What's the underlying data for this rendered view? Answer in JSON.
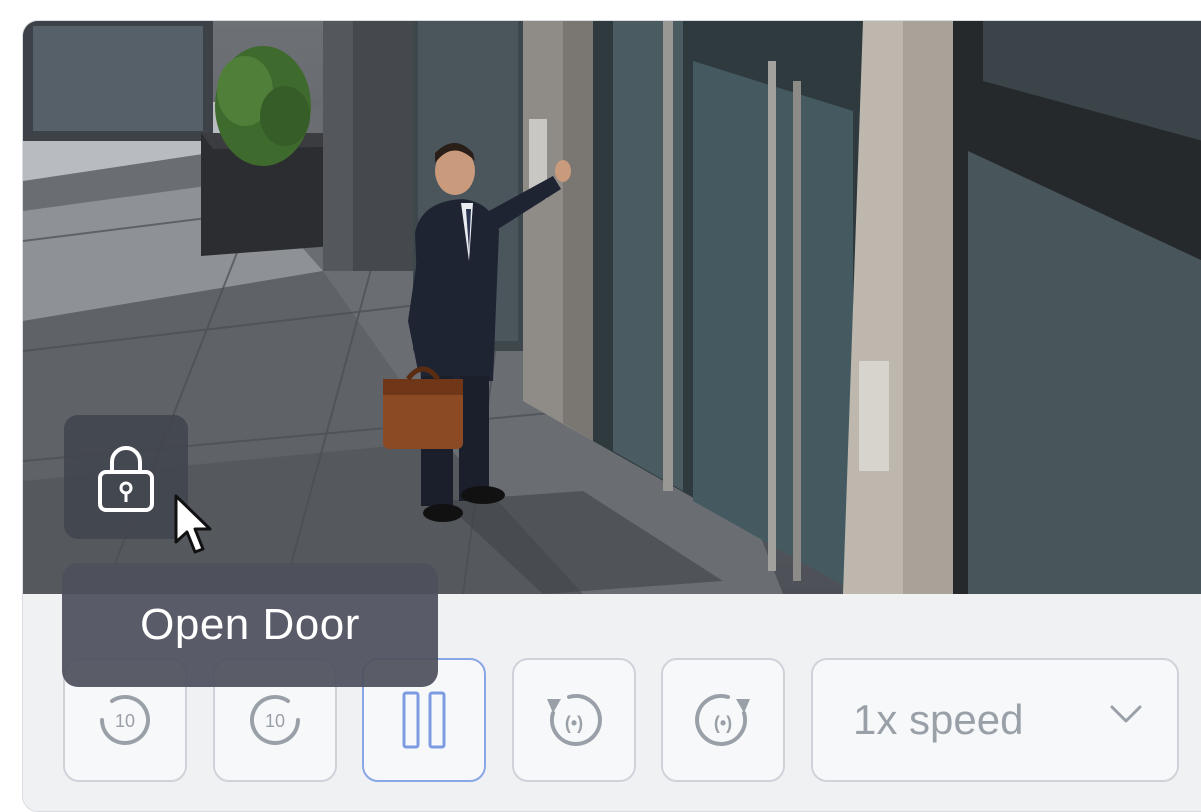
{
  "video": {
    "description_icon": "camera-feed"
  },
  "controls": {
    "rewind_10_label": "10",
    "forward_10_label": "10",
    "pause_icon": "pause-icon",
    "rotate_left_icon": "rotate-left-icon",
    "rotate_right_icon": "rotate-right-icon",
    "speed_value": "1x speed",
    "speed_icon": "chevron-down-icon"
  },
  "overlay": {
    "lock_icon": "lock-icon",
    "tooltip_text": "Open Door"
  },
  "colors": {
    "active_border": "#8aa6e6",
    "button_border": "#cfd3d9",
    "overlay_bg": "#42454e",
    "tooltip_bg": "#4e515c"
  }
}
